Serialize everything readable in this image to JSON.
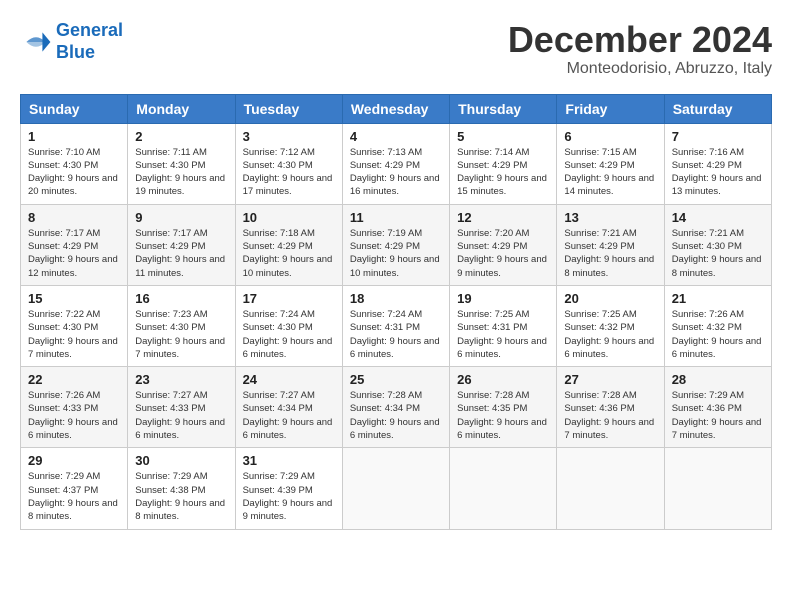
{
  "logo": {
    "line1": "General",
    "line2": "Blue"
  },
  "title": "December 2024",
  "subtitle": "Monteodorisio, Abruzzo, Italy",
  "days_of_week": [
    "Sunday",
    "Monday",
    "Tuesday",
    "Wednesday",
    "Thursday",
    "Friday",
    "Saturday"
  ],
  "weeks": [
    [
      {
        "day": "1",
        "sunrise": "7:10 AM",
        "sunset": "4:30 PM",
        "daylight": "9 hours and 20 minutes."
      },
      {
        "day": "2",
        "sunrise": "7:11 AM",
        "sunset": "4:30 PM",
        "daylight": "9 hours and 19 minutes."
      },
      {
        "day": "3",
        "sunrise": "7:12 AM",
        "sunset": "4:30 PM",
        "daylight": "9 hours and 17 minutes."
      },
      {
        "day": "4",
        "sunrise": "7:13 AM",
        "sunset": "4:29 PM",
        "daylight": "9 hours and 16 minutes."
      },
      {
        "day": "5",
        "sunrise": "7:14 AM",
        "sunset": "4:29 PM",
        "daylight": "9 hours and 15 minutes."
      },
      {
        "day": "6",
        "sunrise": "7:15 AM",
        "sunset": "4:29 PM",
        "daylight": "9 hours and 14 minutes."
      },
      {
        "day": "7",
        "sunrise": "7:16 AM",
        "sunset": "4:29 PM",
        "daylight": "9 hours and 13 minutes."
      }
    ],
    [
      {
        "day": "8",
        "sunrise": "7:17 AM",
        "sunset": "4:29 PM",
        "daylight": "9 hours and 12 minutes."
      },
      {
        "day": "9",
        "sunrise": "7:17 AM",
        "sunset": "4:29 PM",
        "daylight": "9 hours and 11 minutes."
      },
      {
        "day": "10",
        "sunrise": "7:18 AM",
        "sunset": "4:29 PM",
        "daylight": "9 hours and 10 minutes."
      },
      {
        "day": "11",
        "sunrise": "7:19 AM",
        "sunset": "4:29 PM",
        "daylight": "9 hours and 10 minutes."
      },
      {
        "day": "12",
        "sunrise": "7:20 AM",
        "sunset": "4:29 PM",
        "daylight": "9 hours and 9 minutes."
      },
      {
        "day": "13",
        "sunrise": "7:21 AM",
        "sunset": "4:29 PM",
        "daylight": "9 hours and 8 minutes."
      },
      {
        "day": "14",
        "sunrise": "7:21 AM",
        "sunset": "4:30 PM",
        "daylight": "9 hours and 8 minutes."
      }
    ],
    [
      {
        "day": "15",
        "sunrise": "7:22 AM",
        "sunset": "4:30 PM",
        "daylight": "9 hours and 7 minutes."
      },
      {
        "day": "16",
        "sunrise": "7:23 AM",
        "sunset": "4:30 PM",
        "daylight": "9 hours and 7 minutes."
      },
      {
        "day": "17",
        "sunrise": "7:24 AM",
        "sunset": "4:30 PM",
        "daylight": "9 hours and 6 minutes."
      },
      {
        "day": "18",
        "sunrise": "7:24 AM",
        "sunset": "4:31 PM",
        "daylight": "9 hours and 6 minutes."
      },
      {
        "day": "19",
        "sunrise": "7:25 AM",
        "sunset": "4:31 PM",
        "daylight": "9 hours and 6 minutes."
      },
      {
        "day": "20",
        "sunrise": "7:25 AM",
        "sunset": "4:32 PM",
        "daylight": "9 hours and 6 minutes."
      },
      {
        "day": "21",
        "sunrise": "7:26 AM",
        "sunset": "4:32 PM",
        "daylight": "9 hours and 6 minutes."
      }
    ],
    [
      {
        "day": "22",
        "sunrise": "7:26 AM",
        "sunset": "4:33 PM",
        "daylight": "9 hours and 6 minutes."
      },
      {
        "day": "23",
        "sunrise": "7:27 AM",
        "sunset": "4:33 PM",
        "daylight": "9 hours and 6 minutes."
      },
      {
        "day": "24",
        "sunrise": "7:27 AM",
        "sunset": "4:34 PM",
        "daylight": "9 hours and 6 minutes."
      },
      {
        "day": "25",
        "sunrise": "7:28 AM",
        "sunset": "4:34 PM",
        "daylight": "9 hours and 6 minutes."
      },
      {
        "day": "26",
        "sunrise": "7:28 AM",
        "sunset": "4:35 PM",
        "daylight": "9 hours and 6 minutes."
      },
      {
        "day": "27",
        "sunrise": "7:28 AM",
        "sunset": "4:36 PM",
        "daylight": "9 hours and 7 minutes."
      },
      {
        "day": "28",
        "sunrise": "7:29 AM",
        "sunset": "4:36 PM",
        "daylight": "9 hours and 7 minutes."
      }
    ],
    [
      {
        "day": "29",
        "sunrise": "7:29 AM",
        "sunset": "4:37 PM",
        "daylight": "9 hours and 8 minutes."
      },
      {
        "day": "30",
        "sunrise": "7:29 AM",
        "sunset": "4:38 PM",
        "daylight": "9 hours and 8 minutes."
      },
      {
        "day": "31",
        "sunrise": "7:29 AM",
        "sunset": "4:39 PM",
        "daylight": "9 hours and 9 minutes."
      },
      null,
      null,
      null,
      null
    ]
  ]
}
